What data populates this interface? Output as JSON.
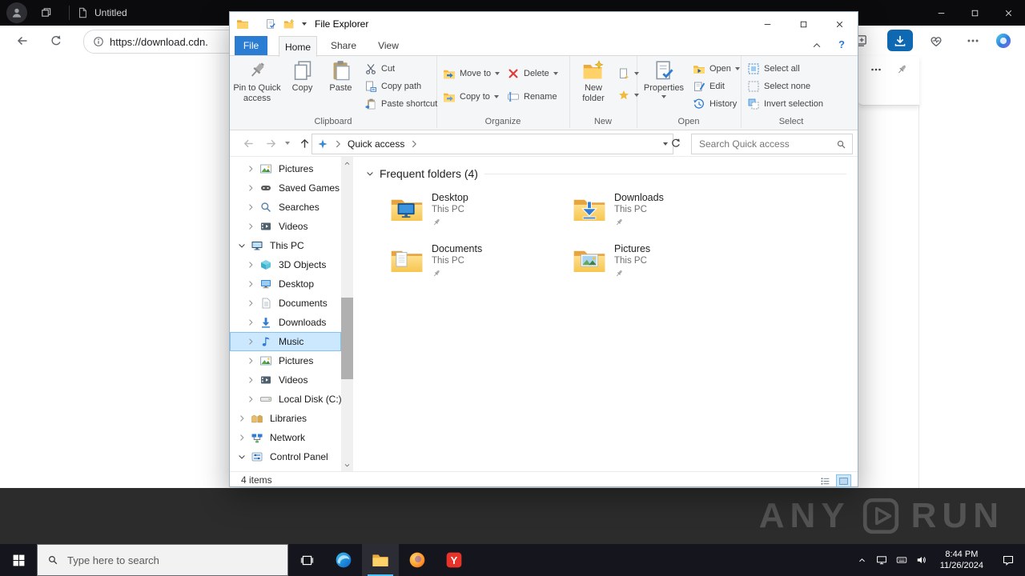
{
  "colors": {
    "accent": "#2b7cd3",
    "selection": "#cce8ff",
    "downloads_button": "#0f68b2",
    "taskbar": "#15151e",
    "folder_yellow": "#ffd269"
  },
  "topbar": {
    "tab_title": "Untitled"
  },
  "browser": {
    "url": "https://download.cdn."
  },
  "explorer": {
    "title": "File Explorer",
    "file_menu": "File",
    "tabs": [
      {
        "label": "Home"
      },
      {
        "label": "Share"
      },
      {
        "label": "View"
      }
    ],
    "active_tab": "Home",
    "help_label": "?",
    "ribbon": {
      "clipboard": {
        "label": "Clipboard",
        "pin_to_quick_access": "Pin to Quick access",
        "copy": "Copy",
        "paste": "Paste",
        "cut": "Cut",
        "copy_path": "Copy path",
        "paste_shortcut": "Paste shortcut"
      },
      "organize": {
        "label": "Organize",
        "move_to": "Move to",
        "copy_to": "Copy to",
        "delete_btn": "Delete",
        "rename": "Rename"
      },
      "new_group": {
        "label": "New",
        "new_folder": "New folder"
      },
      "open_group": {
        "label": "Open",
        "properties": "Properties",
        "open": "Open",
        "edit": "Edit",
        "history": "History"
      },
      "select_group": {
        "label": "Select",
        "select_all": "Select all",
        "select_none": "Select none",
        "invert_selection": "Invert selection"
      }
    },
    "address": {
      "location": "Quick access",
      "search_placeholder": "Search Quick access"
    },
    "nav": [
      {
        "label": "Pictures",
        "icon": "pictures-icon",
        "level": 1,
        "expanded": false,
        "selected": false
      },
      {
        "label": "Saved Games",
        "icon": "saved-games-icon",
        "level": 1,
        "expanded": false,
        "selected": false
      },
      {
        "label": "Searches",
        "icon": "search-nav-icon",
        "level": 1,
        "expanded": false,
        "selected": false
      },
      {
        "label": "Videos",
        "icon": "videos-icon",
        "level": 1,
        "expanded": false,
        "selected": false
      },
      {
        "label": "This PC",
        "icon": "this-pc-icon",
        "level": 0,
        "expanded": true,
        "selected": false
      },
      {
        "label": "3D Objects",
        "icon": "3d-objects-icon",
        "level": 1,
        "expanded": false,
        "selected": false
      },
      {
        "label": "Desktop",
        "icon": "desktop-icon",
        "level": 1,
        "expanded": false,
        "selected": false
      },
      {
        "label": "Documents",
        "icon": "documents-icon",
        "level": 1,
        "expanded": false,
        "selected": false
      },
      {
        "label": "Downloads",
        "icon": "downloads-icon",
        "level": 1,
        "expanded": false,
        "selected": false
      },
      {
        "label": "Music",
        "icon": "music-icon",
        "level": 1,
        "expanded": false,
        "selected": true
      },
      {
        "label": "Pictures",
        "icon": "pictures-icon",
        "level": 1,
        "expanded": false,
        "selected": false
      },
      {
        "label": "Videos",
        "icon": "videos-icon",
        "level": 1,
        "expanded": false,
        "selected": false
      },
      {
        "label": "Local Disk (C:)",
        "icon": "drive-icon",
        "level": 1,
        "expanded": false,
        "selected": false
      },
      {
        "label": "Libraries",
        "icon": "libraries-icon",
        "level": 0,
        "expanded": false,
        "selected": false
      },
      {
        "label": "Network",
        "icon": "network-icon",
        "level": 0,
        "expanded": false,
        "selected": false
      },
      {
        "label": "Control Panel",
        "icon": "control-panel-icon",
        "level": 0,
        "expanded": true,
        "selected": false
      }
    ],
    "content": {
      "section_header": "Frequent folders (4)",
      "tiles": [
        {
          "name": "Desktop",
          "location": "This PC",
          "icon": "tile-desktop-icon"
        },
        {
          "name": "Downloads",
          "location": "This PC",
          "icon": "tile-downloads-icon"
        },
        {
          "name": "Documents",
          "location": "This PC",
          "icon": "tile-documents-icon"
        },
        {
          "name": "Pictures",
          "location": "This PC",
          "icon": "tile-pictures-icon"
        }
      ]
    },
    "status": {
      "items_count": "4 items"
    }
  },
  "taskbar": {
    "search_placeholder": "Type here to search",
    "time": "8:44 PM",
    "date": "11/26/2024"
  },
  "watermark": {
    "left": "ANY",
    "right": "RUN"
  }
}
